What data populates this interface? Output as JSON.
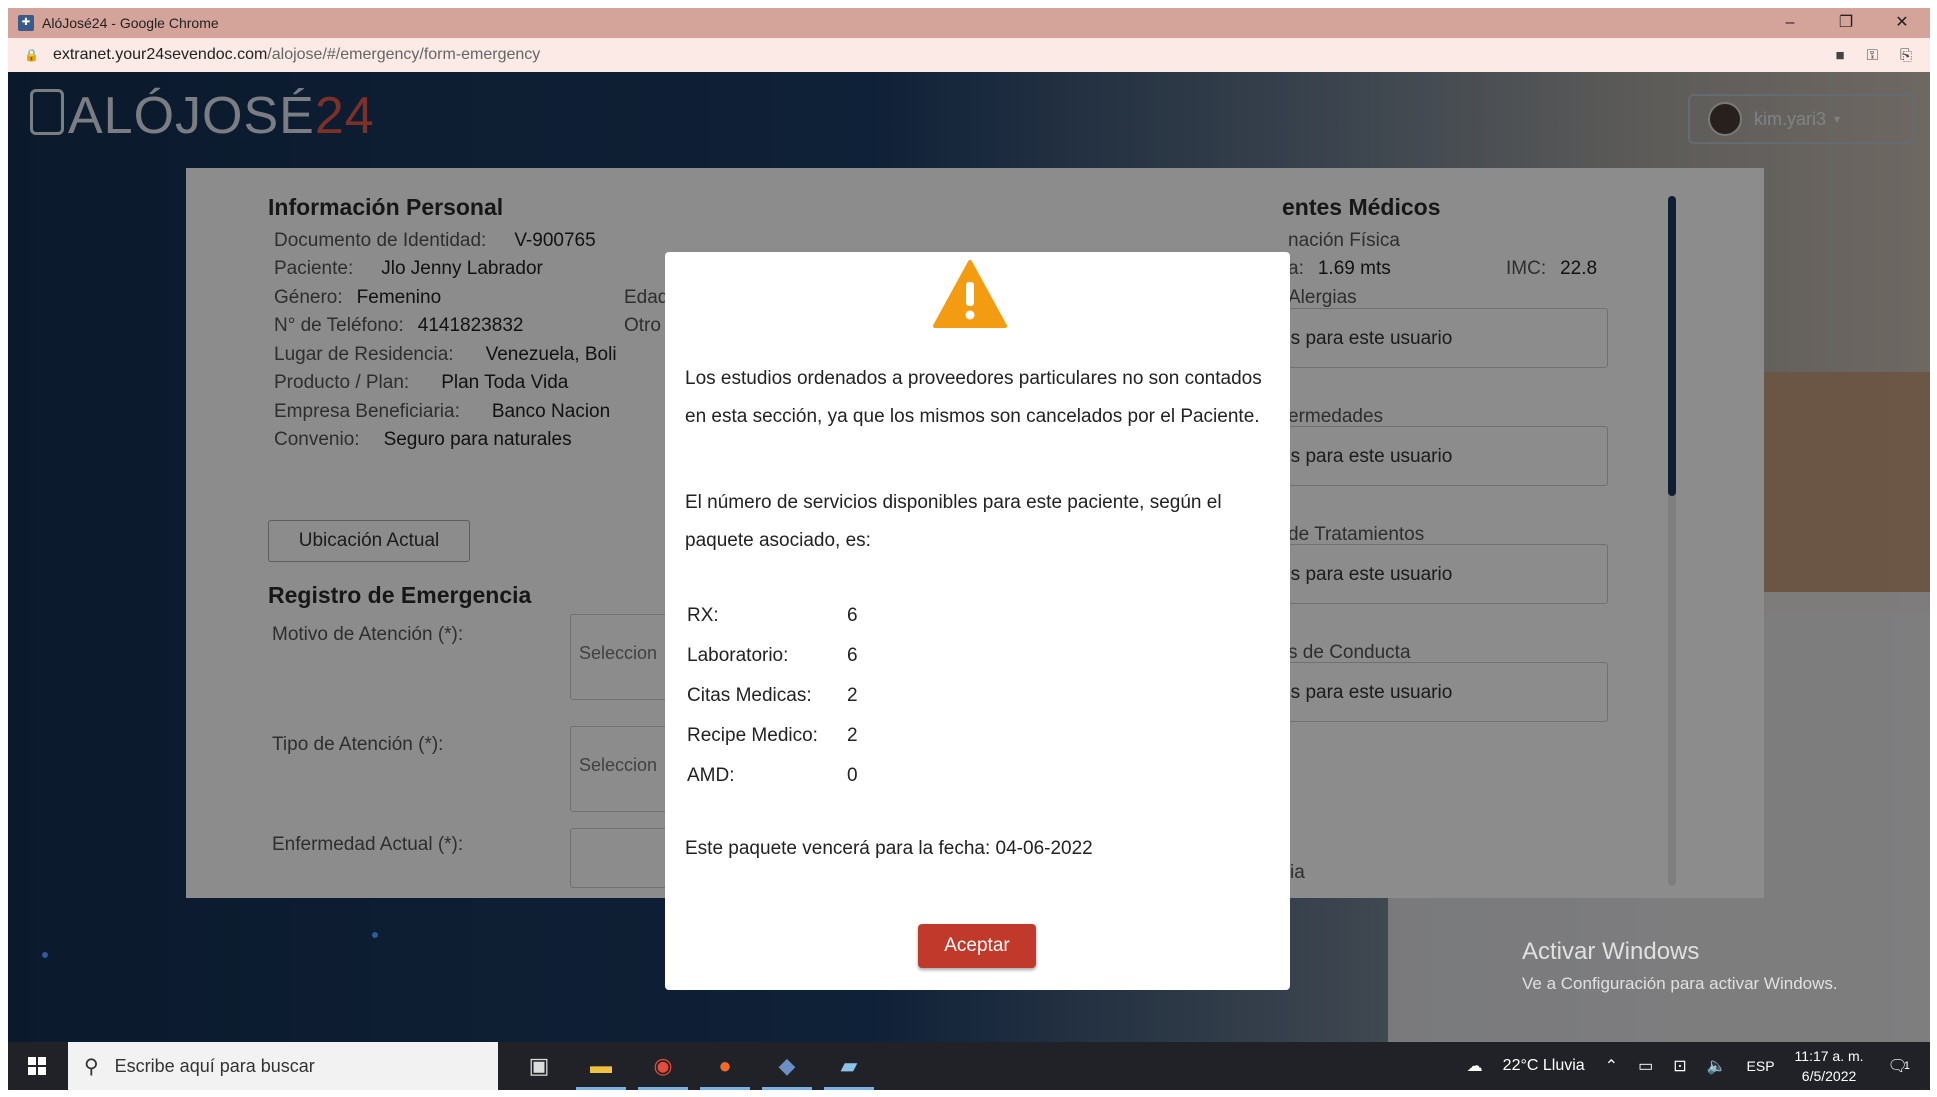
{
  "browser": {
    "window_title": "AlóJosé24 - Google Chrome",
    "url_host": "extranet.your24sevendoc.com",
    "url_path": "/alojose/#/emergency/form-emergency",
    "minimize": "–",
    "restore": "❐",
    "close": "✕"
  },
  "header": {
    "logo_text": "ALÓJOSÉ",
    "logo_num": "24",
    "username": "kim.yari3",
    "caret": "▾"
  },
  "personal": {
    "title": "Información Personal",
    "doc_label": "Documento de Identidad:",
    "doc_value": "V-900765",
    "patient_label": "Paciente:",
    "patient_value": "Jlo Jenny Labrador",
    "gender_label": "Género:",
    "gender_value": "Femenino",
    "age_label": "Edad",
    "phone_label": "N° de Teléfono:",
    "phone_value": "4141823832",
    "other_label": "Otro",
    "residence_label": "Lugar de Residencia:",
    "residence_value": "Venezuela, Boli",
    "product_label": "Producto / Plan:",
    "product_value": "Plan Toda Vida",
    "company_label": "Empresa Beneficiaria:",
    "company_value": "Banco Nacion",
    "agreement_label": "Convenio:",
    "agreement_value": "Seguro para naturales",
    "location_button": "Ubicación Actual"
  },
  "emergency": {
    "title": "Registro de Emergencia",
    "reason_label": "Motivo de Atención (*):",
    "reason_placeholder": "Seleccion",
    "type_label": "Tipo de Atención (*):",
    "type_placeholder": "Seleccion",
    "illness_label": "Enfermedad Actual (*):"
  },
  "medical": {
    "title": "entes Médicos",
    "physical_label": "nación Física",
    "height_label": "a:",
    "height_value": "1.69 mts",
    "imc_label": "IMC:",
    "imc_value": "22.8",
    "allergies_label": "Alergias",
    "diseases_label": "ermedades",
    "treatments_label": "de Tratamientos",
    "conduct_label": "s de Conducta",
    "no_records": "stros para este usuario",
    "partial_button": "ia"
  },
  "modal": {
    "paragraph1": "Los estudios ordenados a proveedores particulares no son contados en esta sección, ya que los mismos son cancelados por el Paciente.",
    "paragraph2": "El número de servicios disponibles para este paciente, según el paquete asociado, es:",
    "services": [
      {
        "name": "RX:",
        "value": "6"
      },
      {
        "name": "Laboratorio:",
        "value": "6"
      },
      {
        "name": "Citas Medicas:",
        "value": "2"
      },
      {
        "name": "Recipe Medico:",
        "value": "2"
      },
      {
        "name": "AMD:",
        "value": "0"
      }
    ],
    "expiry": "Este paquete vencerá para la fecha: 04-06-2022",
    "accept_button": "Aceptar",
    "warning_color": "#f39c12",
    "accept_color": "#c0392b"
  },
  "watermark": {
    "line1": "Activar Windows",
    "line2": "Ve a Configuración para activar Windows."
  },
  "taskbar": {
    "search_placeholder": "Escribe aquí para buscar",
    "weather": "22°C  Lluvia",
    "language": "ESP",
    "time": "11:17 a. m.",
    "date": "6/5/2022",
    "notification_count": "1"
  }
}
